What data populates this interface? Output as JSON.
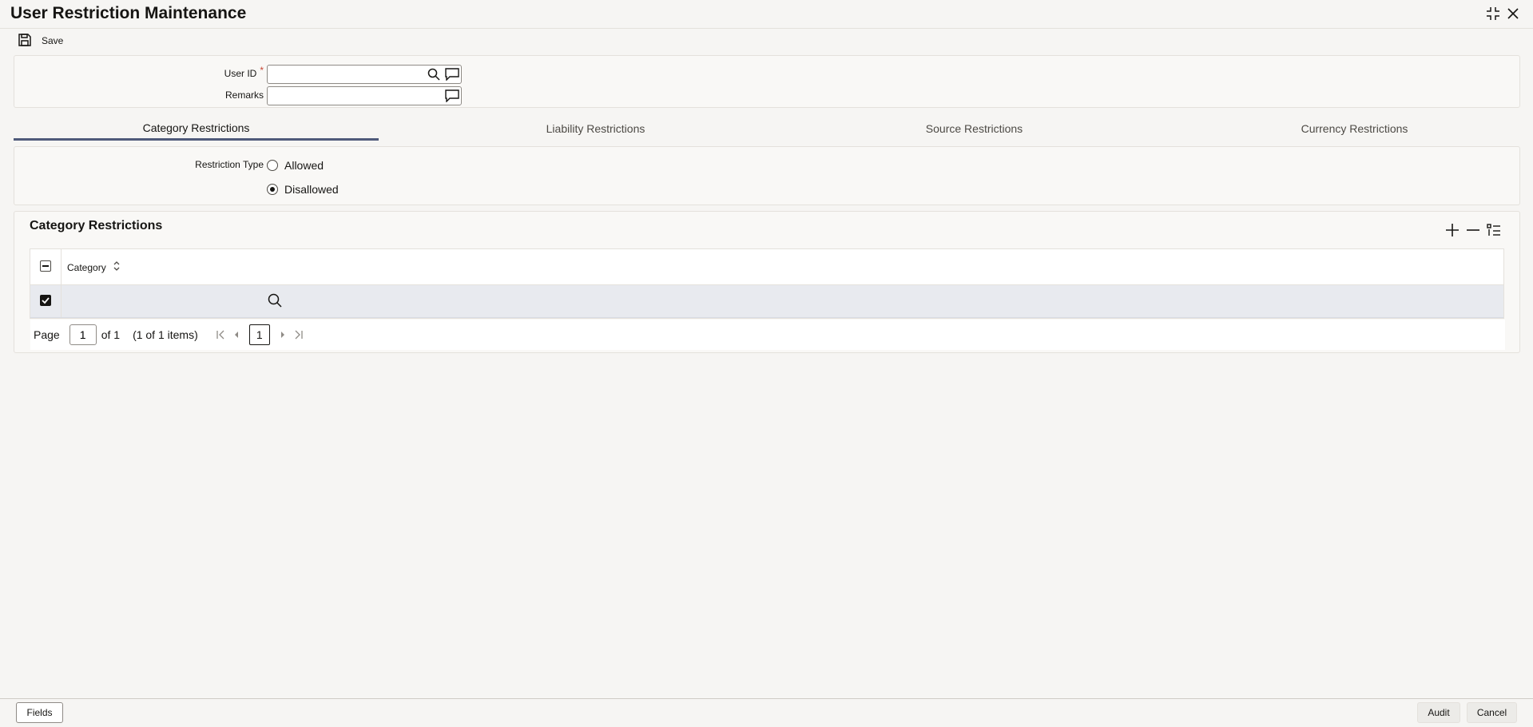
{
  "window": {
    "title": "User Restriction Maintenance",
    "expand_icon": "collapse-arrows-icon",
    "close_icon": "close-icon"
  },
  "toolbar": {
    "save_label": "Save",
    "save_icon": "floppy-disk-icon"
  },
  "form": {
    "user_id": {
      "label": "User ID",
      "required_mark": "*",
      "value": ""
    },
    "remarks": {
      "label": "Remarks",
      "value": ""
    }
  },
  "tabs": [
    {
      "label": "Category Restrictions",
      "active": true
    },
    {
      "label": "Liability Restrictions",
      "active": false
    },
    {
      "label": "Source Restrictions",
      "active": false
    },
    {
      "label": "Currency Restrictions",
      "active": false
    }
  ],
  "restriction_type": {
    "label": "Restriction Type",
    "options": [
      {
        "label": "Allowed",
        "checked": false
      },
      {
        "label": "Disallowed",
        "checked": true
      }
    ]
  },
  "grid": {
    "title": "Category Restrictions",
    "columns": [
      "Category"
    ],
    "rows": [
      {
        "checked": true,
        "category": ""
      }
    ],
    "pager": {
      "page_label": "Page",
      "page_value": "1",
      "of_label": "of 1",
      "items_label": "(1 of 1 items)",
      "current_page": "1"
    }
  },
  "footer": {
    "fields_label": "Fields",
    "audit_label": "Audit",
    "cancel_label": "Cancel"
  },
  "colors": {
    "accent_tab": "#4f5a7a",
    "required": "#c74634",
    "selected_row": "#e8eaef"
  }
}
